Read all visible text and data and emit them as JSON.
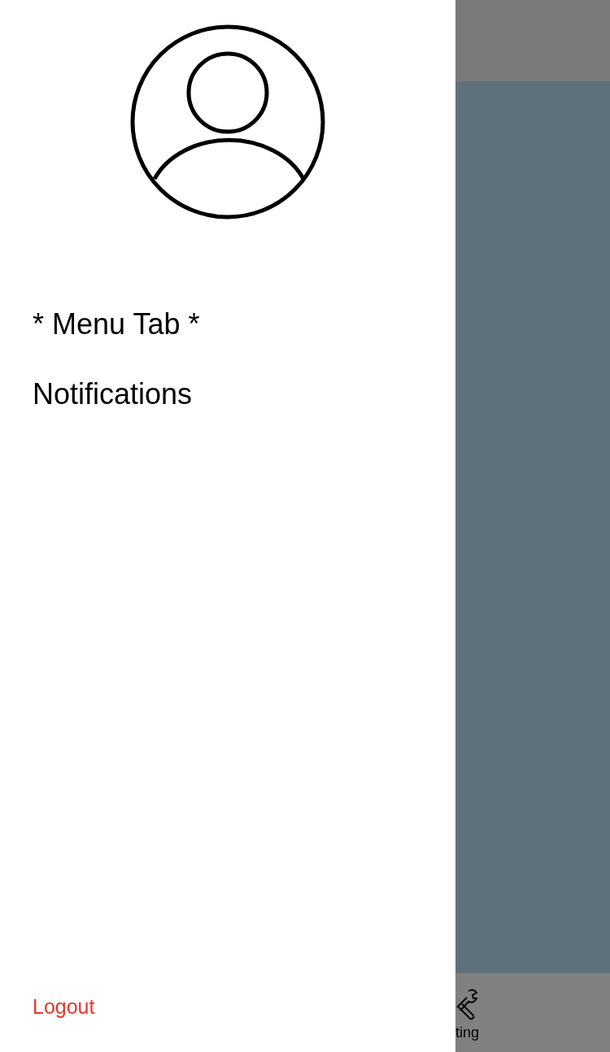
{
  "drawer": {
    "menu_items": [
      {
        "label": "* Menu Tab *"
      },
      {
        "label": "Notifications"
      }
    ],
    "logout": "Logout"
  },
  "tab_bar": {
    "items": [
      {
        "label": "ting"
      }
    ]
  }
}
